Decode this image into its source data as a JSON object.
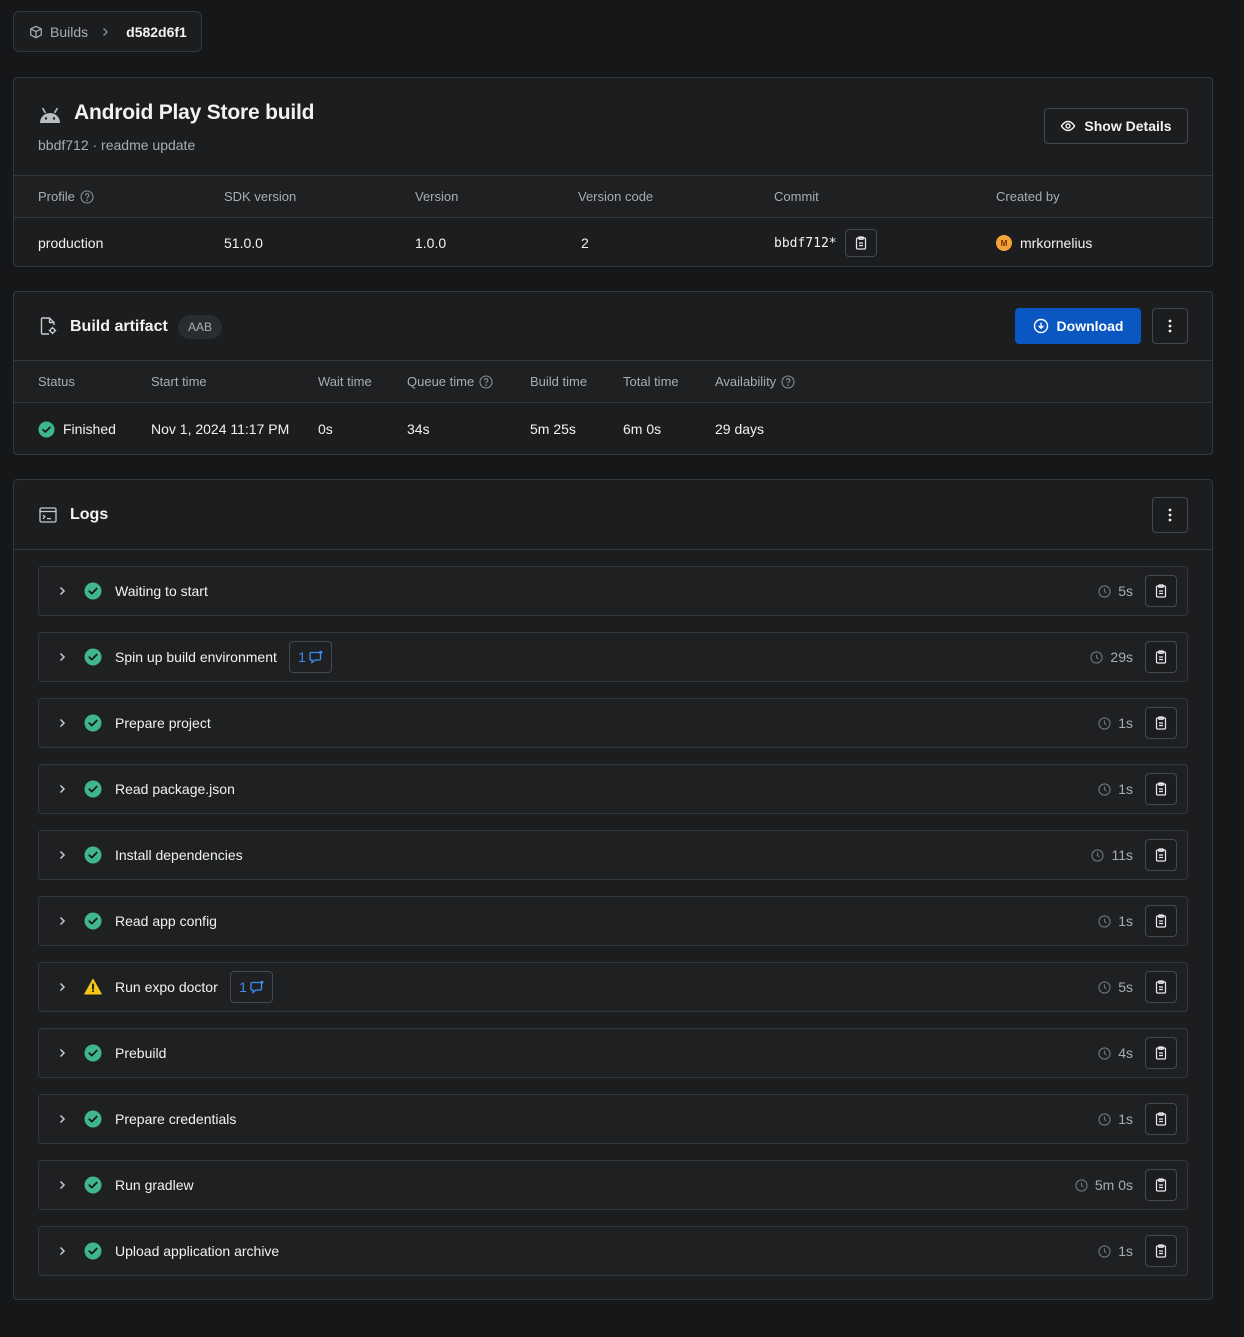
{
  "breadcrumb": {
    "root": "Builds",
    "current": "d582d6f1"
  },
  "build": {
    "title": "Android Play Store build",
    "subtitle": "bbdf712 · readme update",
    "show_details_label": "Show Details",
    "columns": [
      "Profile",
      "SDK version",
      "Version",
      "Version code",
      "Commit",
      "Created by"
    ],
    "values": {
      "profile": "production",
      "sdk_version": "51.0.0",
      "version": "1.0.0",
      "version_code": "2",
      "commit": "bbdf712*",
      "created_by": "mrkornelius",
      "avatar_initial": "M"
    }
  },
  "artifact": {
    "title": "Build artifact",
    "badge": "AAB",
    "download_label": "Download",
    "columns": [
      "Status",
      "Start time",
      "Wait time",
      "Queue time",
      "Build time",
      "Total time",
      "Availability"
    ],
    "values": {
      "status": "Finished",
      "start_time": "Nov 1, 2024 11:17 PM",
      "wait_time": "0s",
      "queue_time": "34s",
      "build_time": "5m 25s",
      "total_time": "6m 0s",
      "availability": "29 days"
    }
  },
  "logs": {
    "title": "Logs",
    "steps": [
      {
        "label": "Waiting to start",
        "duration": "5s",
        "status": "success"
      },
      {
        "label": "Spin up build environment",
        "duration": "29s",
        "status": "success",
        "messages": "1"
      },
      {
        "label": "Prepare project",
        "duration": "1s",
        "status": "success"
      },
      {
        "label": "Read package.json",
        "duration": "1s",
        "status": "success"
      },
      {
        "label": "Install dependencies",
        "duration": "11s",
        "status": "success"
      },
      {
        "label": "Read app config",
        "duration": "1s",
        "status": "success"
      },
      {
        "label": "Run expo doctor",
        "duration": "5s",
        "status": "warning",
        "messages": "1"
      },
      {
        "label": "Prebuild",
        "duration": "4s",
        "status": "success"
      },
      {
        "label": "Prepare credentials",
        "duration": "1s",
        "status": "success"
      },
      {
        "label": "Run gradlew",
        "duration": "5m 0s",
        "status": "success"
      },
      {
        "label": "Upload application archive",
        "duration": "1s",
        "status": "success"
      }
    ]
  },
  "colors": {
    "background": "#151718",
    "card": "#1b1d1f",
    "border": "#34383c",
    "accent_blue": "#0a57c2",
    "success": "#3fb68b",
    "warning": "#f5c518"
  },
  "icons": {
    "breadcrumb": "cube-icon",
    "build": "android-icon",
    "artifact": "file-settings-icon",
    "logs": "terminal-icon",
    "copy": "clipboard-icon",
    "duration": "clock-icon",
    "expand": "chevron-right-icon"
  }
}
